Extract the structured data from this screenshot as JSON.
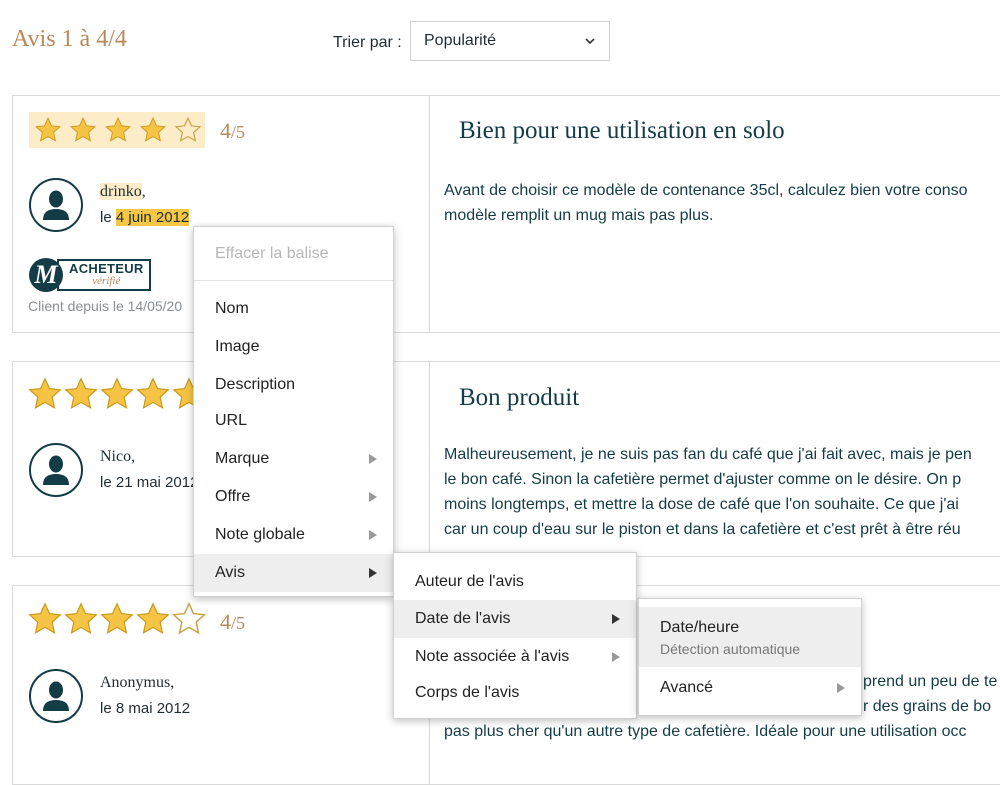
{
  "header": {
    "count_title": "Avis 1 à 4/4",
    "sort_label": "Trier par :",
    "sort_value": "Popularité"
  },
  "reviews": [
    {
      "rating": 4,
      "score": "4",
      "score_suffix": "/5",
      "author": "drinko",
      "author_suffix": ",",
      "date_prefix": "le",
      "date": "4 juin 2012",
      "badge_line1": "ACHETEUR",
      "badge_line2": "vérifié",
      "client_since": "Client depuis le 14/05/20",
      "title": "Bien pour une utilisation en solo",
      "body": [
        "Avant de choisir ce modèle de contenance 35cl, calculez bien votre conso",
        "modèle remplit un mug mais pas plus."
      ]
    },
    {
      "rating": 5,
      "score": "",
      "author": "Nico",
      "author_suffix": ",",
      "date_prefix": "le",
      "date": "21 mai 2012",
      "title": "Bon produit",
      "body": [
        "Malheureusement, je ne suis pas fan du café que j'ai fait avec, mais je pen",
        "le bon café. Sinon la cafetière permet d'ajuster comme on le désire. On p",
        "moins longtemps, et mettre la dose de café que l'on souhaite. Ce que j'ai",
        "car un coup d'eau sur le piston et dans la cafetière et c'est prêt à être réu"
      ]
    },
    {
      "rating": 4,
      "score": "4",
      "score_suffix": "/5",
      "author": "Anonymus",
      "author_suffix": ",",
      "date_prefix": "le",
      "date": "8 mai 2012",
      "body": [
        "prend un peu de te",
        "r des grains de bo",
        "pas plus cher qu'un autre type de cafetière. Idéale pour une utilisation occ"
      ]
    }
  ],
  "context_menu": {
    "clear": "Effacer la balise",
    "items": [
      "Nom",
      "Image",
      "Description",
      "URL",
      "Marque",
      "Offre",
      "Note globale",
      "Avis"
    ]
  },
  "submenu_avis": {
    "items": [
      "Auteur de l'avis",
      "Date de l'avis",
      "Note associée à l'avis",
      "Corps de l'avis"
    ]
  },
  "submenu_date": {
    "datetime_label": "Date/heure",
    "datetime_sub": "Détection automatique",
    "advanced": "Avancé"
  },
  "colors": {
    "accent_gold": "#b8895a",
    "star_fill": "#f6c445",
    "title_teal": "#143c46",
    "highlight_light": "#fdecc8",
    "highlight_strong": "#f6c747"
  }
}
